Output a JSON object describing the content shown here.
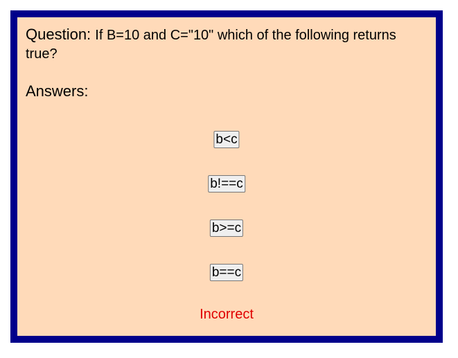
{
  "question": {
    "label": "Question:",
    "text": "If B=10 and C=\"10\" which of the following returns true?"
  },
  "answers_heading": "Answers:",
  "answers": [
    {
      "label": "b<c"
    },
    {
      "label": "b!==c"
    },
    {
      "label": "b>=c"
    },
    {
      "label": "b==c"
    }
  ],
  "result": {
    "text": "Incorrect",
    "color": "#e00000"
  },
  "colors": {
    "frame_border": "#00008b",
    "background": "#ffdab9"
  }
}
